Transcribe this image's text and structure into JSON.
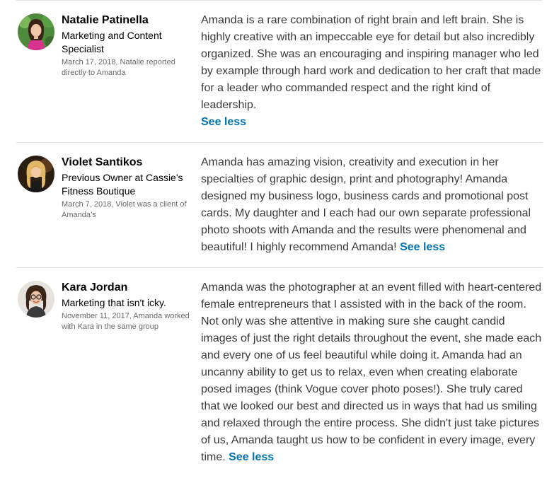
{
  "recommendations": [
    {
      "name": "Natalie Patinella",
      "headline": "Marketing and Content Specialist",
      "meta": "March 17, 2018, Natalie reported directly to Amanda",
      "text": "Amanda is a rare combination of right brain and left brain. She is highly creative with an impeccable eye for detail but also incredibly organized. She was an encouraging and inspiring manager who led by example through hard work and dedication to her craft that made for a leader who commanded respect and the right kind of leadership.",
      "see_less": "See less"
    },
    {
      "name": "Violet Santikos",
      "headline": "Previous Owner at Cassie's Fitness Boutique",
      "meta": "March 7, 2018, Violet was a client of Amanda’s",
      "text": "Amanda has amazing vision, creativity and execution in her specialties of graphic design, print and photography! Amanda designed my business logo, business cards and promotional post cards. My daughter and I each had our own separate professional photo shoots with Amanda and the results were phenomenal and beautiful! I highly recommend Amanda!",
      "see_less": "See less"
    },
    {
      "name": "Kara Jordan",
      "headline": "Marketing that isn't icky.",
      "meta": "November 11, 2017, Amanda worked with Kara in the same group",
      "text": "Amanda was the photographer at an event filled with heart-centered female entrepreneurs that I assisted with in the back of the room. Not only was she attentive in making sure she caught candid images of just the right details throughout the event, she made each and every one of us feel beautiful while doing it. Amanda had an uncanny ability to get us to relax, even when creating elaborate posed images (think Vogue cover photo poses!). She truly cared that we looked our best and directed us in ways that had us smiling and relaxed through the entire process. She didn't just take pictures of us, Amanda taught us how to be confident in every image, every time.",
      "see_less": "See less"
    }
  ],
  "colors": {
    "link": "#0073b1",
    "divider": "#e1e1e1"
  }
}
